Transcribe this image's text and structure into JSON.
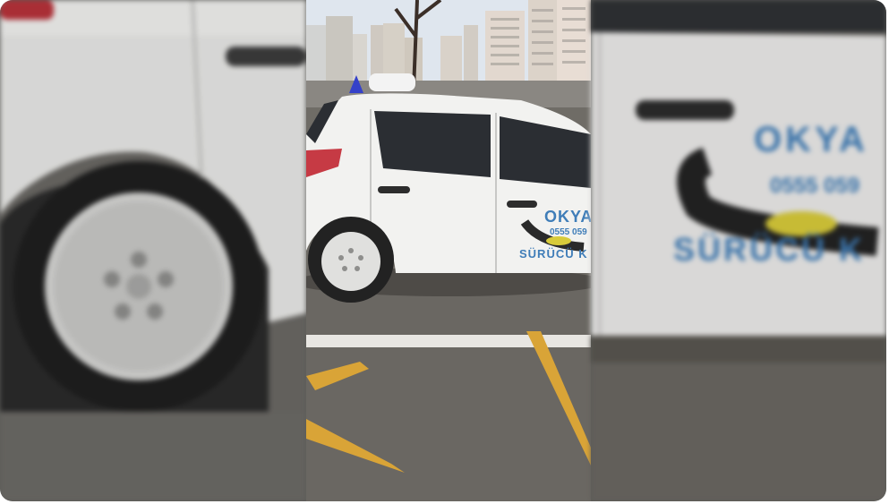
{
  "video": {
    "description_hidden": false,
    "car_sticker": {
      "brand": "OKYA",
      "phone": "0555 059",
      "subtitle": "SÜRÜCÜ K",
      "blur_brand": "OKYA",
      "blur_phone": "0555 059",
      "blur_subtitle": "SÜRÜCÜ K"
    },
    "colors": {
      "car_body": "#f2f2f0",
      "asphalt": "#6f6c66",
      "yellow_line": "#d9a437",
      "sky": "#dfe6ee",
      "sticker_blue": "#3f7db8"
    }
  }
}
